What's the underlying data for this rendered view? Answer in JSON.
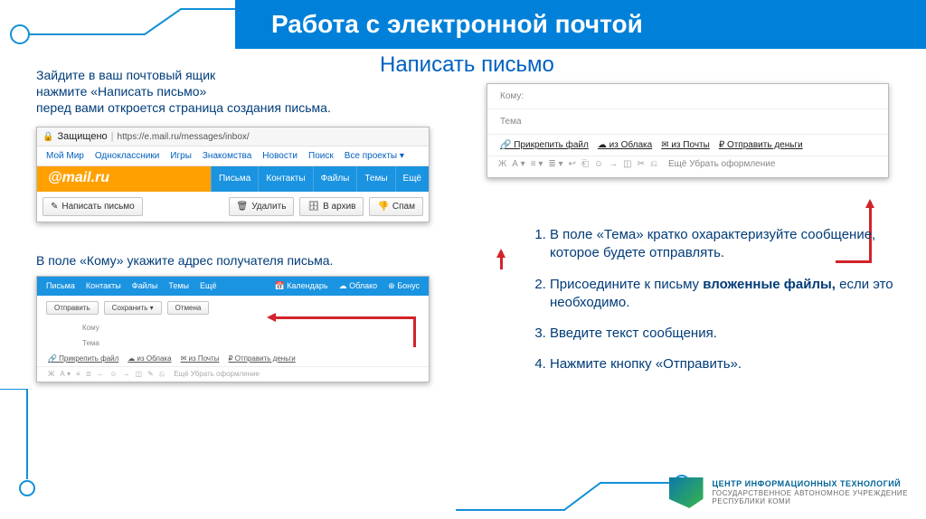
{
  "header": {
    "title": "Работа с электронной почтой"
  },
  "subtitle": "Написать письмо",
  "instructLeft": "Зайдите в ваш почтовый ящик\nнажмите «Написать письмо»\nперед вами откроется страница создания письма.",
  "instructMid": "В поле «Кому» укажите адрес получателя письма.",
  "shot1": {
    "secure": "Защищено",
    "url": "https://e.mail.ru/messages/inbox/",
    "subnav": [
      "Мой Мир",
      "Одноклассники",
      "Игры",
      "Знакомства",
      "Новости",
      "Поиск",
      "Все проекты ▾"
    ],
    "logo": "@mail.ru",
    "tabs": [
      "Письма",
      "Контакты",
      "Файлы",
      "Темы",
      "Ещё"
    ],
    "compose": "Написать письмо",
    "delete": "Удалить",
    "archive": "В архив",
    "spam": "Спам"
  },
  "shot2": {
    "bluebar": [
      "Письма",
      "Контакты",
      "Файлы",
      "Темы",
      "Ещё",
      "📅 Календарь",
      "☁ Облако",
      "⊕ Бонус"
    ],
    "send": "Отправить",
    "save": "Сохранить ▾",
    "cancel": "Отмена",
    "to_label": "Кому",
    "subject_label": "Тема",
    "attach": [
      "🔗 Прикрепить файл",
      "☁ из Облака",
      "✉ из Почты",
      "₽ Отправить деньги"
    ],
    "toolbartail": "Ещё   Убрать оформление"
  },
  "shot3": {
    "to_label": "Кому:",
    "subject_label": "Тема",
    "attach": [
      "🔗 Прикрепить файл",
      "☁ из Облака",
      "✉ из Почты",
      "₽ Отправить деньги"
    ],
    "toolbartail": "Ещё   Убрать оформление"
  },
  "steps": [
    "В поле «Тема» кратко охарактеризуйте сообщение, которое будете отправлять.",
    "Присоедините к письму **вложенные файлы,** если это необходимо.",
    "Введите текст сообщения.",
    "Нажмите кнопку «Отправить»."
  ],
  "footer": {
    "line1": "ЦЕНТР ИНФОРМАЦИОННЫХ ТЕХНОЛОГИЙ",
    "line2": "ГОСУДАРСТВЕННОЕ АВТОНОМНОЕ УЧРЕЖДЕНИЕ",
    "line3": "РЕСПУБЛИКИ КОМИ"
  }
}
